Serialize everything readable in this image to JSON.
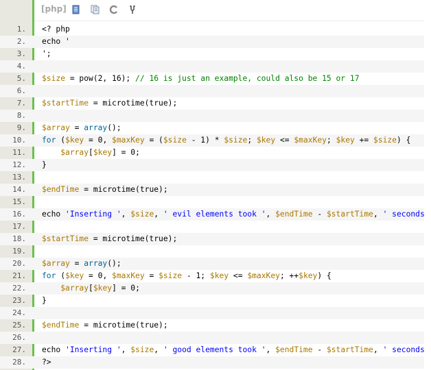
{
  "toolbar": {
    "language": "[php]",
    "icons": [
      "view-source-icon",
      "copy-icon",
      "refresh-icon",
      "help-icon"
    ]
  },
  "colors": {
    "gutter": "#e8e8e0",
    "accent_bar": "#6cbf4e",
    "variable": "#aa7700",
    "keyword": "#006699",
    "string": "#0000ff",
    "comment": "#008200"
  },
  "lines": [
    {
      "n": "1.",
      "tokens": [
        {
          "t": "<? php",
          "c": ""
        }
      ]
    },
    {
      "n": "2.",
      "tokens": [
        {
          "t": "echo '",
          "c": ""
        }
      ]
    },
    {
      "n": "3.",
      "tokens": [
        {
          "t": "';",
          "c": ""
        }
      ]
    },
    {
      "n": "4.",
      "tokens": []
    },
    {
      "n": "5.",
      "tokens": [
        {
          "t": "$size",
          "c": "v"
        },
        {
          "t": " = pow(2, 16); ",
          "c": ""
        },
        {
          "t": "// 16 is just an example, could also be 15 or 17",
          "c": "cm"
        }
      ]
    },
    {
      "n": "6.",
      "tokens": []
    },
    {
      "n": "7.",
      "tokens": [
        {
          "t": "$startTime",
          "c": "v"
        },
        {
          "t": " = microtime(true);",
          "c": ""
        }
      ]
    },
    {
      "n": "8.",
      "tokens": []
    },
    {
      "n": "9.",
      "tokens": [
        {
          "t": "$array",
          "c": "v"
        },
        {
          "t": " = ",
          "c": ""
        },
        {
          "t": "array",
          "c": "kw"
        },
        {
          "t": "();",
          "c": ""
        }
      ]
    },
    {
      "n": "10.",
      "tokens": [
        {
          "t": "for",
          "c": "kw"
        },
        {
          "t": " (",
          "c": ""
        },
        {
          "t": "$key",
          "c": "v"
        },
        {
          "t": " = 0, ",
          "c": ""
        },
        {
          "t": "$maxKey",
          "c": "v"
        },
        {
          "t": " = (",
          "c": ""
        },
        {
          "t": "$size",
          "c": "v"
        },
        {
          "t": " - 1) * ",
          "c": ""
        },
        {
          "t": "$size",
          "c": "v"
        },
        {
          "t": "; ",
          "c": ""
        },
        {
          "t": "$key",
          "c": "v"
        },
        {
          "t": " <= ",
          "c": ""
        },
        {
          "t": "$maxKey",
          "c": "v"
        },
        {
          "t": "; ",
          "c": ""
        },
        {
          "t": "$key",
          "c": "v"
        },
        {
          "t": " += ",
          "c": ""
        },
        {
          "t": "$size",
          "c": "v"
        },
        {
          "t": ") {",
          "c": ""
        }
      ]
    },
    {
      "n": "11.",
      "tokens": [
        {
          "t": "    ",
          "c": ""
        },
        {
          "t": "$array",
          "c": "v"
        },
        {
          "t": "[",
          "c": ""
        },
        {
          "t": "$key",
          "c": "v"
        },
        {
          "t": "] = 0;",
          "c": ""
        }
      ]
    },
    {
      "n": "12.",
      "tokens": [
        {
          "t": "}",
          "c": ""
        }
      ]
    },
    {
      "n": "13.",
      "tokens": []
    },
    {
      "n": "14.",
      "tokens": [
        {
          "t": "$endTime",
          "c": "v"
        },
        {
          "t": " = microtime(true);",
          "c": ""
        }
      ]
    },
    {
      "n": "15.",
      "tokens": []
    },
    {
      "n": "16.",
      "tokens": [
        {
          "t": "echo ",
          "c": ""
        },
        {
          "t": "'Inserting '",
          "c": "st"
        },
        {
          "t": ", ",
          "c": ""
        },
        {
          "t": "$size",
          "c": "v"
        },
        {
          "t": ", ",
          "c": ""
        },
        {
          "t": "' evil elements took '",
          "c": "st"
        },
        {
          "t": ", ",
          "c": ""
        },
        {
          "t": "$endTime",
          "c": "v"
        },
        {
          "t": " - ",
          "c": ""
        },
        {
          "t": "$startTime",
          "c": "v"
        },
        {
          "t": ", ",
          "c": ""
        },
        {
          "t": "' seconds",
          "c": "st"
        }
      ]
    },
    {
      "n": "17.",
      "tokens": []
    },
    {
      "n": "18.",
      "tokens": [
        {
          "t": "$startTime",
          "c": "v"
        },
        {
          "t": " = microtime(true);",
          "c": ""
        }
      ]
    },
    {
      "n": "19.",
      "tokens": []
    },
    {
      "n": "20.",
      "tokens": [
        {
          "t": "$array",
          "c": "v"
        },
        {
          "t": " = ",
          "c": ""
        },
        {
          "t": "array",
          "c": "kw"
        },
        {
          "t": "();",
          "c": ""
        }
      ]
    },
    {
      "n": "21.",
      "tokens": [
        {
          "t": "for",
          "c": "kw"
        },
        {
          "t": " (",
          "c": ""
        },
        {
          "t": "$key",
          "c": "v"
        },
        {
          "t": " = 0, ",
          "c": ""
        },
        {
          "t": "$maxKey",
          "c": "v"
        },
        {
          "t": " = ",
          "c": ""
        },
        {
          "t": "$size",
          "c": "v"
        },
        {
          "t": " - 1; ",
          "c": ""
        },
        {
          "t": "$key",
          "c": "v"
        },
        {
          "t": " <= ",
          "c": ""
        },
        {
          "t": "$maxKey",
          "c": "v"
        },
        {
          "t": "; ++",
          "c": ""
        },
        {
          "t": "$key",
          "c": "v"
        },
        {
          "t": ") {",
          "c": ""
        }
      ]
    },
    {
      "n": "22.",
      "tokens": [
        {
          "t": "    ",
          "c": ""
        },
        {
          "t": "$array",
          "c": "v"
        },
        {
          "t": "[",
          "c": ""
        },
        {
          "t": "$key",
          "c": "v"
        },
        {
          "t": "] = 0;",
          "c": ""
        }
      ]
    },
    {
      "n": "23.",
      "tokens": [
        {
          "t": "}",
          "c": ""
        }
      ]
    },
    {
      "n": "24.",
      "tokens": []
    },
    {
      "n": "25.",
      "tokens": [
        {
          "t": "$endTime",
          "c": "v"
        },
        {
          "t": " = microtime(true);",
          "c": ""
        }
      ]
    },
    {
      "n": "26.",
      "tokens": []
    },
    {
      "n": "27.",
      "tokens": [
        {
          "t": "echo ",
          "c": ""
        },
        {
          "t": "'Inserting '",
          "c": "st"
        },
        {
          "t": ", ",
          "c": ""
        },
        {
          "t": "$size",
          "c": "v"
        },
        {
          "t": ", ",
          "c": ""
        },
        {
          "t": "' good elements took '",
          "c": "st"
        },
        {
          "t": ", ",
          "c": ""
        },
        {
          "t": "$endTime",
          "c": "v"
        },
        {
          "t": " - ",
          "c": ""
        },
        {
          "t": "$startTime",
          "c": "v"
        },
        {
          "t": ", ",
          "c": ""
        },
        {
          "t": "' seconds",
          "c": "st"
        }
      ]
    },
    {
      "n": "28.",
      "tokens": [
        {
          "t": "?>",
          "c": ""
        }
      ]
    }
  ]
}
